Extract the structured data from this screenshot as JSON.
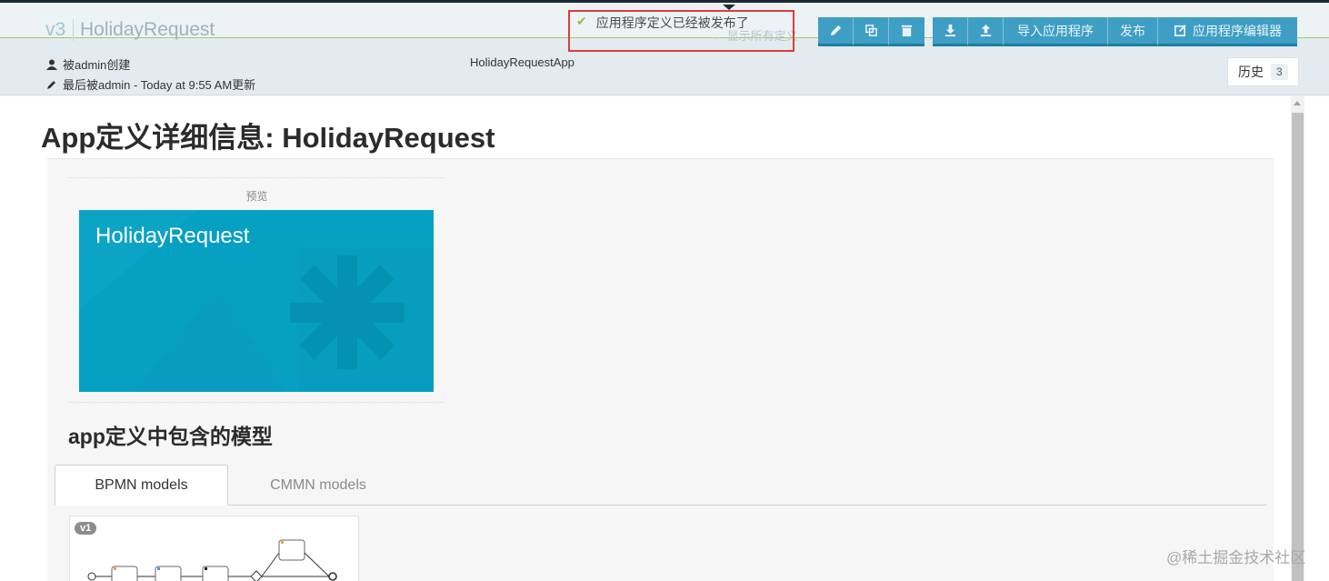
{
  "header": {
    "version": "v3",
    "app_name": "HolidayRequest",
    "back_link": "← 显示所有定义",
    "created_by": "被admin创建",
    "modified_by": "最后被admin - Today at 9:55 AM更新",
    "app_key": "HolidayRequestApp",
    "history_label": "历史",
    "history_count": "3"
  },
  "toolbar": {
    "icon_buttons": [
      "pencil-icon",
      "copy-icon",
      "trash-icon",
      "download-icon",
      "upload-icon"
    ],
    "import_label": "导入应用程序",
    "publish_label": "发布",
    "editor_label": "应用程序编辑器"
  },
  "notification": {
    "message": "应用程序定义已经被发布了",
    "icon": "check-icon"
  },
  "main": {
    "title": "App定义详细信息: HolidayRequest",
    "preview_label": "预览",
    "tile_title": "HolidayRequest",
    "tile_color": "#06a0c2",
    "models_heading": "app定义中包含的模型",
    "tabs": [
      {
        "label": "BPMN models",
        "active": true
      },
      {
        "label": "CMMN models",
        "active": false
      }
    ],
    "model_card": {
      "version_badge": "v1"
    }
  },
  "watermark": "@稀土掘金技术社区",
  "colors": {
    "toolbar_button": "#3f9ec4",
    "notice_border": "#e03b3b",
    "success_check": "#8ec14a"
  }
}
